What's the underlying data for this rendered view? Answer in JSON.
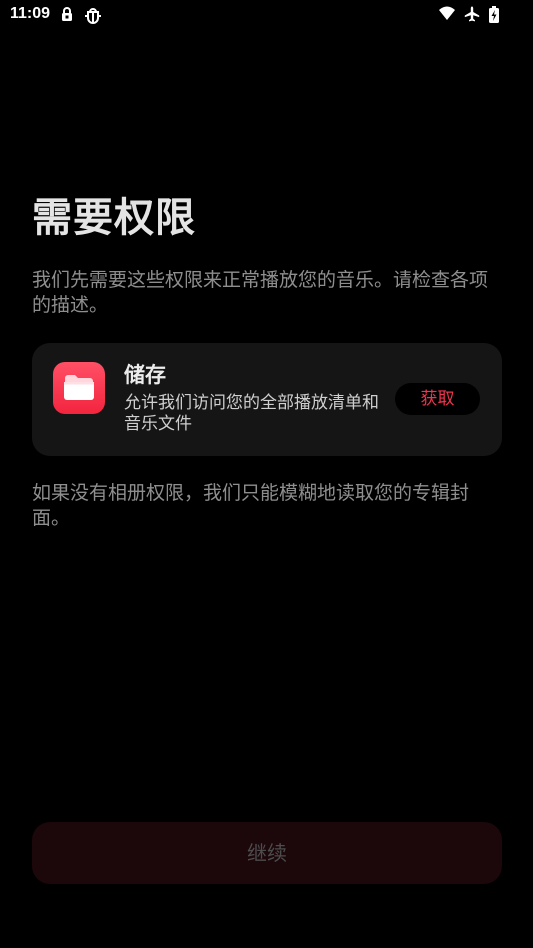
{
  "status_bar": {
    "time": "11:09",
    "icons": [
      "lock-icon",
      "bug-icon",
      "wifi-icon",
      "airplane-icon",
      "battery-charging-icon"
    ]
  },
  "header": {
    "title": "需要权限",
    "description": "我们先需要这些权限来正常播放您的音乐。请检查各项的描述。"
  },
  "permission": {
    "icon": "folder-icon",
    "title": "储存",
    "description": "允许我们访问您的全部播放清单和音乐文件",
    "grant_label": "获取"
  },
  "notes": {
    "album_art": "如果没有相册权限，我们只能模糊地读取您的专辑封面。"
  },
  "footer": {
    "continue_label": "继续"
  },
  "colors": {
    "background": "#000000",
    "card": "#151515",
    "accent": "#f2344f",
    "icon_gradient_top": "#ff5066",
    "icon_gradient_bottom": "#f3243e",
    "continue_bg": "#1c070b"
  }
}
